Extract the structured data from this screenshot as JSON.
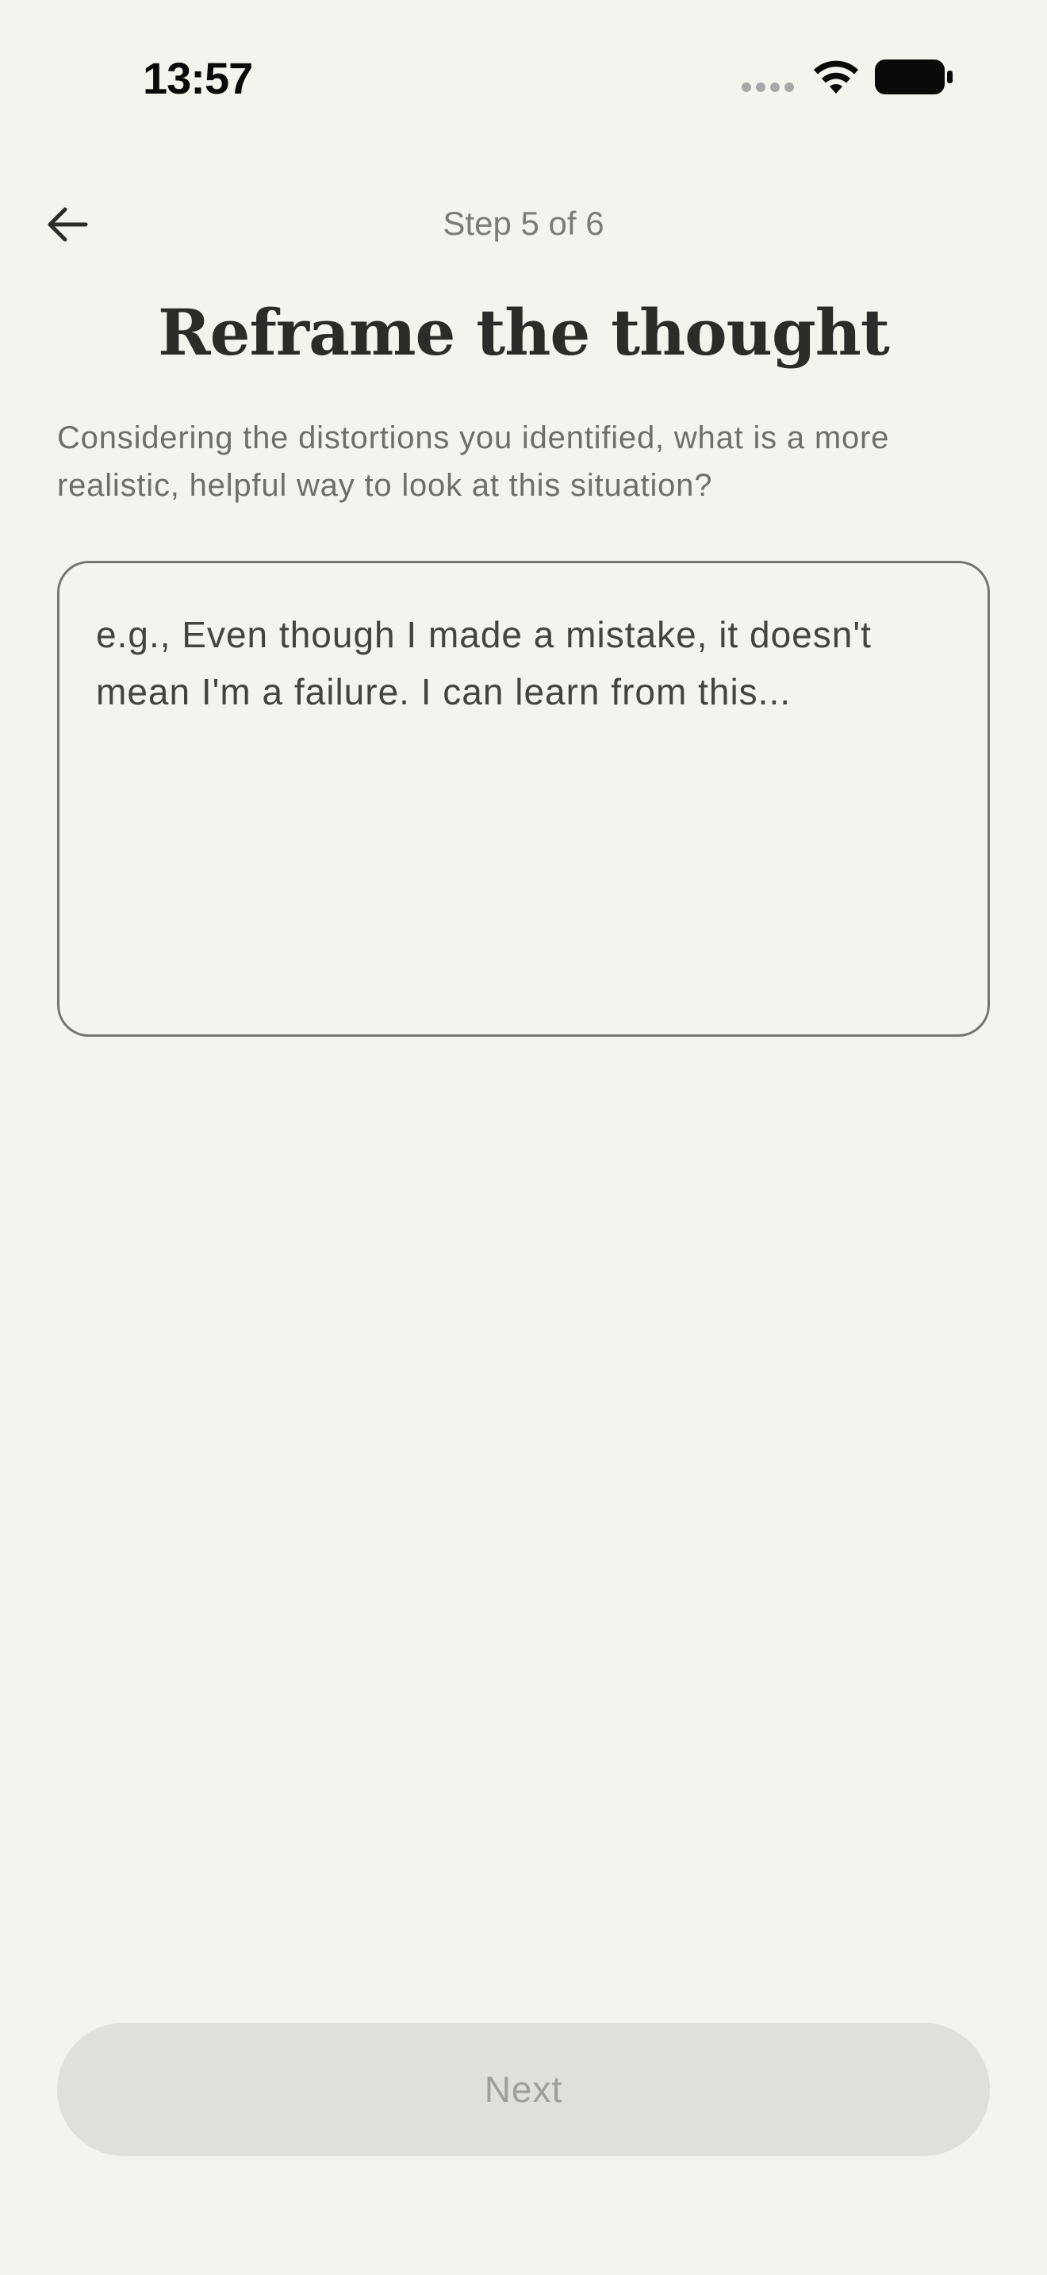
{
  "status_bar": {
    "time": "13:57",
    "icons": [
      "cellular-signal-icon",
      "wifi-icon",
      "battery-icon"
    ]
  },
  "nav": {
    "back_icon": "arrow-left-icon",
    "step_label": "Step 5 of 6"
  },
  "content": {
    "title": "Reframe the thought",
    "instructions": "Considering the distortions you identified, what is a more realistic, helpful way to look at this situation?",
    "textarea": {
      "value": "",
      "placeholder": "e.g., Even though I made a mistake, it doesn't mean I'm a failure. I can learn from this..."
    }
  },
  "footer": {
    "next_label": "Next",
    "next_enabled": false
  },
  "colors": {
    "background": "#f4f4ef",
    "text_primary": "#2b2b29",
    "text_secondary": "#6e6e6b",
    "border": "#747471",
    "button_disabled_bg": "#e0e0db",
    "button_disabled_text": "#9e9e9a"
  }
}
